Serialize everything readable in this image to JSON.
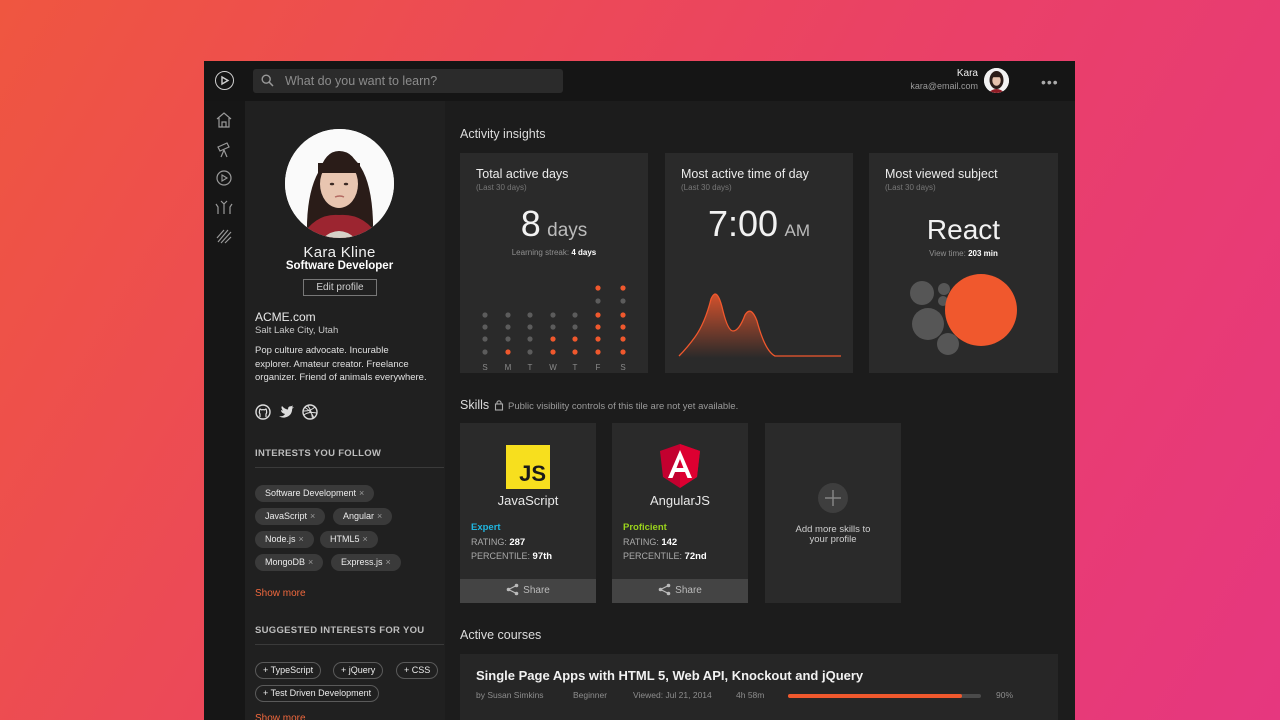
{
  "header": {
    "search_placeholder": "What do you want to learn?",
    "user_name": "Kara",
    "user_email": "kara@email.com",
    "more_label": "•••"
  },
  "sidebar": {
    "items": [
      {
        "icon": "home-icon"
      },
      {
        "icon": "telescope-icon"
      },
      {
        "icon": "play-icon"
      },
      {
        "icon": "paths-icon"
      },
      {
        "icon": "channels-icon"
      }
    ]
  },
  "profile": {
    "name": "Kara Kline",
    "role": "Software Developer",
    "edit_label": "Edit profile",
    "website": "ACME.com",
    "location": "Salt Lake City, Utah",
    "bio": "Pop culture advocate. Incurable explorer. Amateur creator. Freelance organizer. Friend of animals everywhere.",
    "interests_title": "INTERESTS YOU FOLLOW",
    "interests": [
      "Software Development",
      "JavaScript",
      "Angular",
      "Node.js",
      "HTML5",
      "MongoDB",
      "Express.js"
    ],
    "show_more": "Show more",
    "suggested_title": "SUGGESTED INTERESTS FOR YOU",
    "suggested": [
      "+ TypeScript",
      "+ jQuery",
      "+ CSS",
      "+ Test Driven Development"
    ]
  },
  "activity": {
    "title": "Activity insights",
    "total_days": {
      "title": "Total active days",
      "sub": "(Last 30 days)",
      "value": "8",
      "unit": "days",
      "streak_label": "Learning streak:",
      "streak_value": "4 days",
      "day_labels": [
        "S",
        "M",
        "T",
        "W",
        "T",
        "F",
        "S"
      ]
    },
    "time_of_day": {
      "title": "Most active time of day",
      "sub": "(Last 30 days)",
      "value": "7:00",
      "unit": "AM"
    },
    "subject": {
      "title": "Most viewed subject",
      "sub": "(Last 30 days)",
      "value": "React",
      "view_label": "View time:",
      "view_value": "203 min"
    }
  },
  "skills": {
    "title": "Skills",
    "note": "Public visibility controls of this tile are not yet available.",
    "cards": [
      {
        "name": "JavaScript",
        "badge": "JS",
        "level": "Expert",
        "level_color": "#1fb6e0",
        "rating_label": "RATING:",
        "rating": "287",
        "percentile_label": "PERCENTILE:",
        "percentile": "97th",
        "share": "Share"
      },
      {
        "name": "AngularJS",
        "badge": "A",
        "level": "Proficient",
        "level_color": "#9ad21c",
        "rating_label": "RATING:",
        "rating": "142",
        "percentile_label": "PERCENTILE:",
        "percentile": "72nd",
        "share": "Share"
      }
    ],
    "add_label": "Add more skills to your profile"
  },
  "courses": {
    "title": "Active courses",
    "items": [
      {
        "title": "Single Page Apps with HTML 5, Web API, Knockout and jQuery",
        "author": "by Susan Simkins",
        "level": "Beginner",
        "viewed": "Viewed: Jul 21, 2014",
        "duration": "4h 58m",
        "progress_text": "90%",
        "progress": 0.9
      }
    ]
  },
  "colors": {
    "accent": "#f0582d",
    "expert": "#1fb6e0",
    "proficient": "#9ad21c"
  }
}
